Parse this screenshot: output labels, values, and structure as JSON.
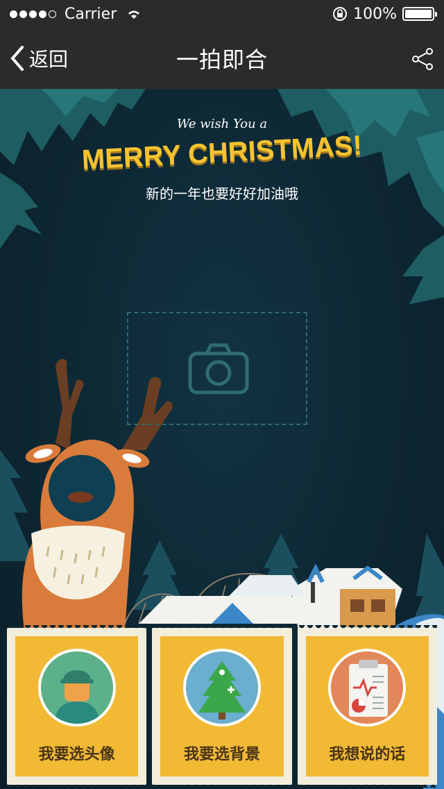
{
  "status": {
    "carrier": "Carrier",
    "battery": "100%"
  },
  "nav": {
    "back_label": "返回",
    "title": "一拍即合"
  },
  "greeting": {
    "line1": "We wish You a",
    "line2": "MERRY CHRISTMAS!",
    "subtitle": "新的一年也要好好加油哦"
  },
  "stamps": [
    {
      "label": "我要选头像",
      "icon": "avatar-icon"
    },
    {
      "label": "我要选背景",
      "icon": "christmas-tree-icon"
    },
    {
      "label": "我想说的话",
      "icon": "clipboard-icon"
    }
  ],
  "colors": {
    "bar": "#2b2b2b",
    "scene": "#0d2733",
    "gold": "#f6c331",
    "stamp": "#f1b934"
  }
}
